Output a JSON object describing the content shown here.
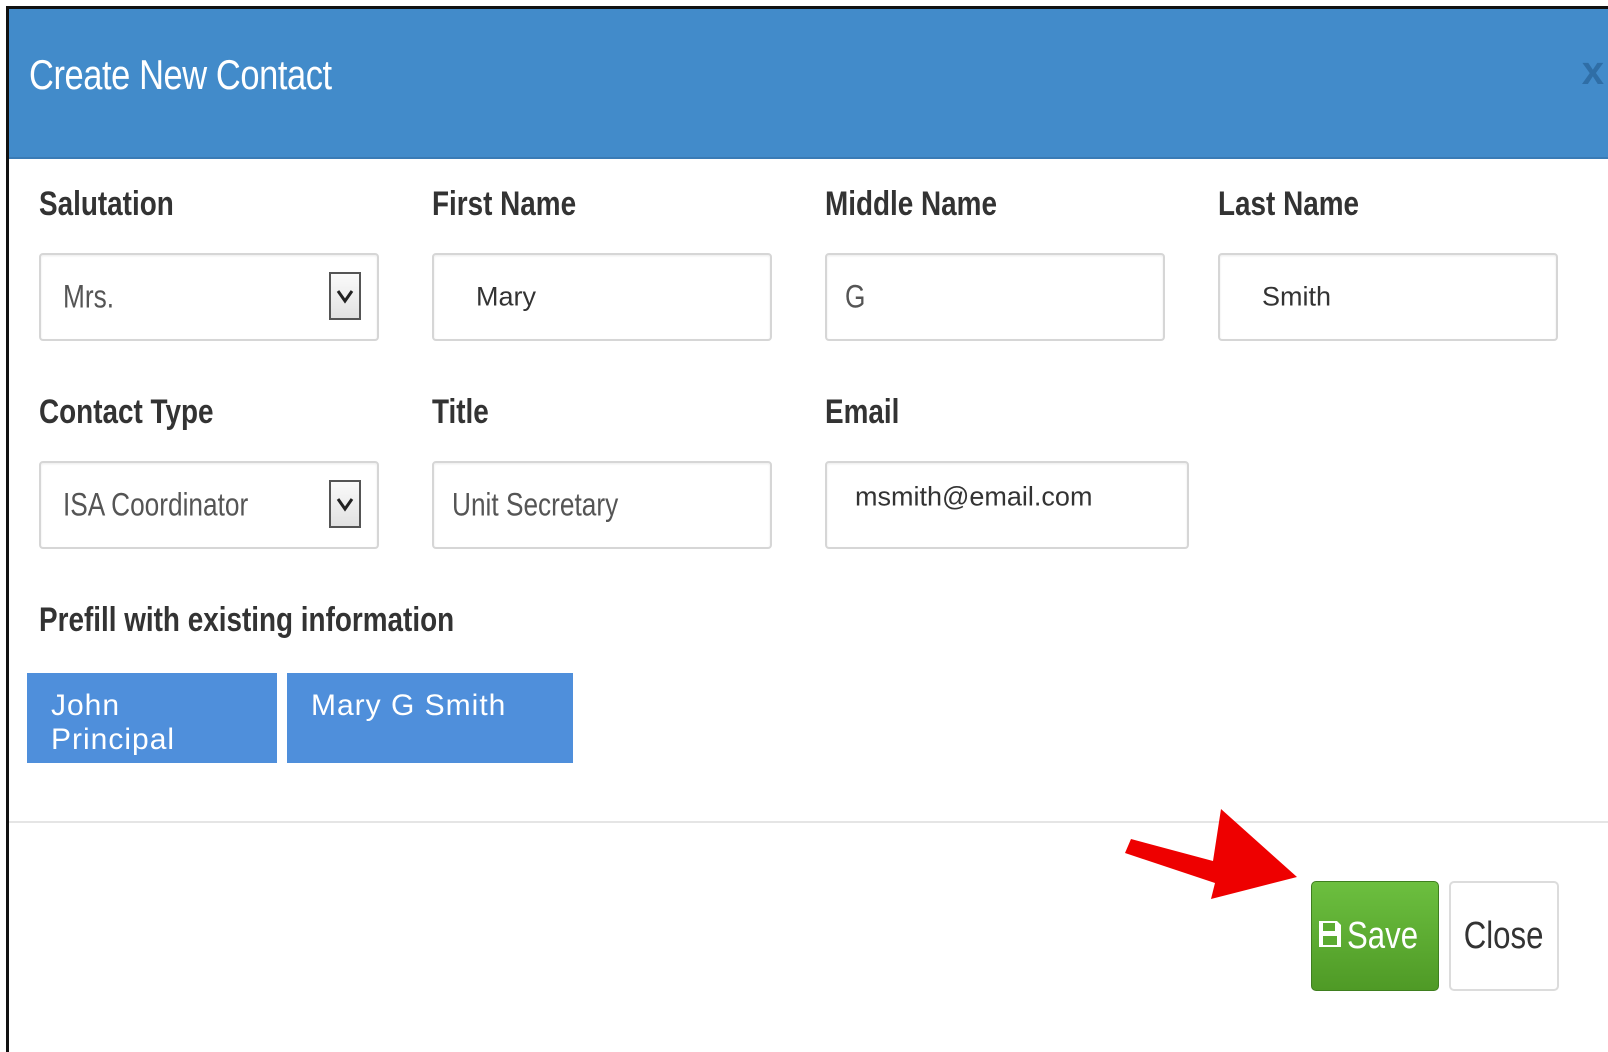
{
  "modal": {
    "title": "Create New Contact",
    "close_glyph": "x"
  },
  "form": {
    "salutation": {
      "label": "Salutation",
      "value": "Mrs."
    },
    "first_name": {
      "label": "First Name",
      "value": "Mary"
    },
    "middle_name": {
      "label": "Middle Name",
      "value": "G"
    },
    "last_name": {
      "label": "Last Name",
      "value": "Smith"
    },
    "contact_type": {
      "label": "Contact Type",
      "value": "ISA Coordinator"
    },
    "title": {
      "label": "Title",
      "value": "Unit Secretary"
    },
    "email": {
      "label": "Email",
      "value": "msmith@email.com"
    }
  },
  "prefill": {
    "label": "Prefill with existing information",
    "options": [
      "John Principal",
      "Mary G Smith"
    ]
  },
  "footer": {
    "save_label": "Save",
    "close_label": "Close"
  },
  "icons": {
    "save": "floppy-disk-icon",
    "select": "chevron-down-icon",
    "annotation": "red-arrow-icon"
  },
  "colors": {
    "header": "#428bca",
    "prefill_button": "#4f8fdb",
    "save_button": "#5cab32",
    "annotation_arrow": "#ee0000"
  }
}
